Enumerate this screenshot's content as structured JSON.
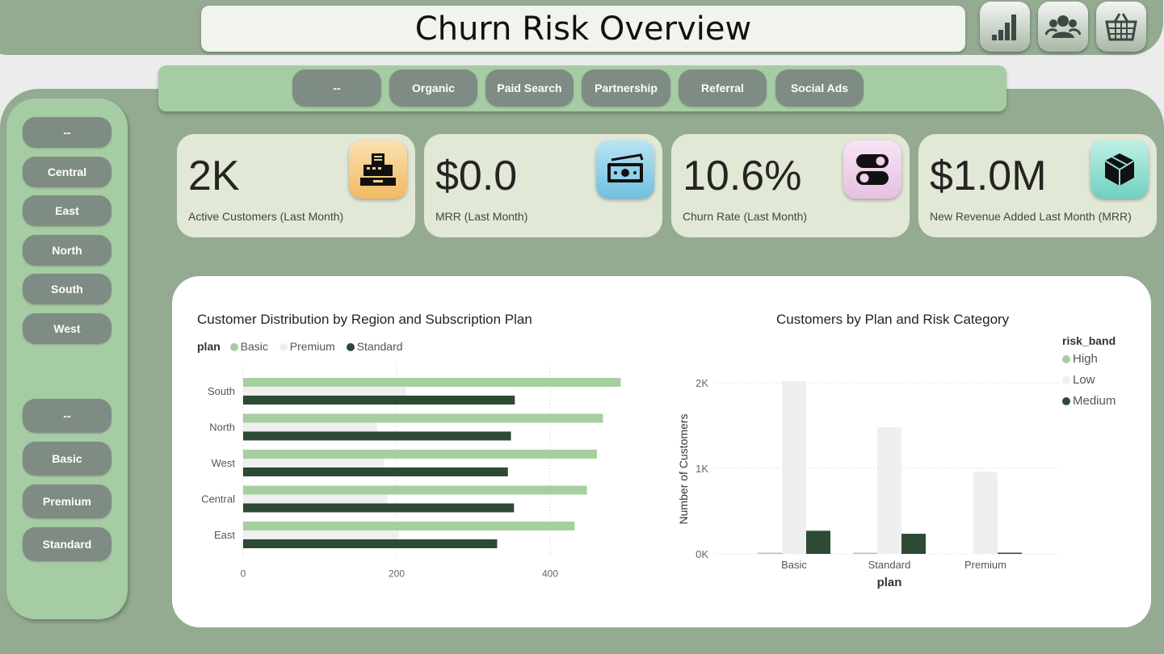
{
  "header": {
    "title": "Churn Risk Overview",
    "nav_icons": [
      "bar-chart-icon",
      "users-icon",
      "basket-icon"
    ]
  },
  "channel_filter": [
    "--",
    "Organic",
    "Paid Search",
    "Partnership",
    "Referral",
    "Social Ads"
  ],
  "region_filter": [
    "--",
    "Central",
    "East",
    "North",
    "South",
    "West"
  ],
  "plan_filter": [
    "--",
    "Basic",
    "Premium",
    "Standard"
  ],
  "kpis": [
    {
      "value": "2K",
      "label": "Active Customers (Last Month)",
      "icon": "cash-register-icon",
      "icon_color": "#f2c576"
    },
    {
      "value": "$0.0",
      "label": "MRR (Last Month)",
      "icon": "money-icon",
      "icon_color": "#8fd0ea"
    },
    {
      "value": "10.6%",
      "label": "Churn Rate (Last Month)",
      "icon": "toggle-icon",
      "icon_color": "#f0d0ec"
    },
    {
      "value": "$1.0M",
      "label": "New Revenue Added Last Month (MRR)",
      "icon": "box-icon",
      "icon_color": "#8fdcd0"
    }
  ],
  "colors": {
    "basic": "#a6cf9f",
    "premium": "#efefef",
    "standard": "#2c4a34",
    "accent_bg": "#94ab92",
    "pill": "#7f8c84"
  },
  "chart_data": [
    {
      "type": "bar",
      "orientation": "horizontal",
      "title": "Customer Distribution by Region and Subscription Plan",
      "legend_title": "plan",
      "categories": [
        "South",
        "North",
        "West",
        "Central",
        "East"
      ],
      "series": [
        {
          "name": "Basic",
          "values": [
            492,
            469,
            461,
            448,
            432
          ]
        },
        {
          "name": "Premium",
          "values": [
            212,
            175,
            184,
            188,
            203
          ]
        },
        {
          "name": "Standard",
          "values": [
            354,
            349,
            345,
            353,
            331
          ]
        }
      ],
      "xlim": [
        0,
        500
      ],
      "xticks": [
        "0",
        "200",
        "400"
      ],
      "grid": true,
      "legend_position": "top-left"
    },
    {
      "type": "bar",
      "title": "Customers by Plan and Risk Category",
      "legend_title": "risk_band",
      "xlabel": "plan",
      "ylabel": "Number of Customers",
      "categories": [
        "Basic",
        "Standard",
        "Premium"
      ],
      "series": [
        {
          "name": "High",
          "values": [
            10,
            10,
            0
          ]
        },
        {
          "name": "Low",
          "values": [
            2020,
            1480,
            960
          ]
        },
        {
          "name": "Medium",
          "values": [
            270,
            235,
            10
          ]
        }
      ],
      "ylim": [
        0,
        2000
      ],
      "yticks": [
        "0K",
        "1K",
        "2K"
      ],
      "grid": true,
      "legend_position": "right"
    }
  ]
}
